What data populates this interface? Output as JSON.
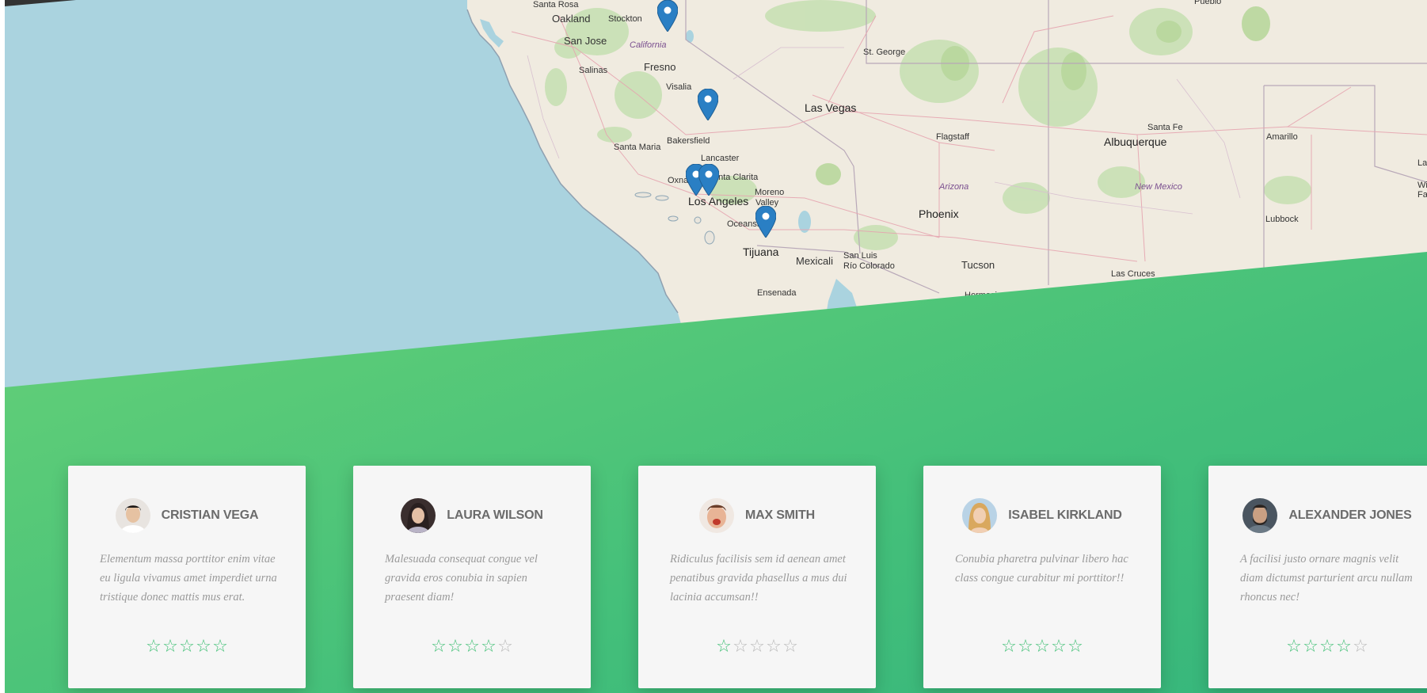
{
  "map": {
    "labels": [
      {
        "key": "santa_rosa",
        "text": "Santa Rosa"
      },
      {
        "key": "oakland",
        "text": "Oakland"
      },
      {
        "key": "stockton",
        "text": "Stockton"
      },
      {
        "key": "san_jose",
        "text": "San Jose"
      },
      {
        "key": "california",
        "text": "California"
      },
      {
        "key": "salinas",
        "text": "Salinas"
      },
      {
        "key": "fresno",
        "text": "Fresno"
      },
      {
        "key": "visalia",
        "text": "Visalia"
      },
      {
        "key": "bakersfield",
        "text": "Bakersfield"
      },
      {
        "key": "santa_maria",
        "text": "Santa Maria"
      },
      {
        "key": "lancaster",
        "text": "Lancaster"
      },
      {
        "key": "oxnard",
        "text": "Oxnar"
      },
      {
        "key": "santa_clarita",
        "text": "anta Clarita"
      },
      {
        "key": "los_angeles",
        "text": "Los Angeles"
      },
      {
        "key": "moreno_valley_1",
        "text": "Moreno"
      },
      {
        "key": "moreno_valley_2",
        "text": "Valley"
      },
      {
        "key": "oceanside",
        "text": "Oceansid"
      },
      {
        "key": "tijuana",
        "text": "Tijuana"
      },
      {
        "key": "mexicali",
        "text": "Mexicali"
      },
      {
        "key": "san_luis_1",
        "text": "San Luis"
      },
      {
        "key": "san_luis_2",
        "text": "Río Colorado"
      },
      {
        "key": "ensenada",
        "text": "Ensenada"
      },
      {
        "key": "las_vegas",
        "text": "Las Vegas"
      },
      {
        "key": "st_george",
        "text": "St. George"
      },
      {
        "key": "flagstaff",
        "text": "Flagstaff"
      },
      {
        "key": "arizona",
        "text": "Arizona"
      },
      {
        "key": "phoenix",
        "text": "Phoenix"
      },
      {
        "key": "tucson",
        "text": "Tucson"
      },
      {
        "key": "hermosillo",
        "text": "Hermosi"
      },
      {
        "key": "albuquerque",
        "text": "Albuquerque"
      },
      {
        "key": "santa_fe",
        "text": "Santa Fe"
      },
      {
        "key": "new_mexico",
        "text": "New Mexico"
      },
      {
        "key": "las_cruces",
        "text": "Las Cruces"
      },
      {
        "key": "amarillo",
        "text": "Amarillo"
      },
      {
        "key": "lubbock",
        "text": "Lubbock"
      },
      {
        "key": "pueblo",
        "text": "Pueblo"
      },
      {
        "key": "law",
        "text": "Law"
      },
      {
        "key": "wic",
        "text": "Wic"
      },
      {
        "key": "fa",
        "text": "Fa"
      }
    ],
    "marker_icon": "map-pin-icon",
    "marker_color": "#2a7fc4"
  },
  "colors": {
    "green_start": "#79d477",
    "green_end": "#35b57c",
    "star_on": "#3fbf74",
    "star_off": "#b8b8b8"
  },
  "testimonials": [
    {
      "name": "CRISTIAN VEGA",
      "text": "Elementum massa porttitor enim vitae eu ligula vivamus amet imperdiet urna tristique donec mattis mus erat.",
      "rating": 5,
      "stars": [
        "☆",
        "☆",
        "☆",
        "☆",
        "☆"
      ]
    },
    {
      "name": "LAURA WILSON",
      "text": "Malesuada consequat congue vel gravida eros conubia in sapien praesent diam!",
      "rating": 4,
      "stars": [
        "☆",
        "☆",
        "☆",
        "☆",
        "☆"
      ]
    },
    {
      "name": "MAX SMITH",
      "text": "Ridiculus facilisis sem id aenean amet penatibus gravida phasellus a mus dui lacinia accumsan!!",
      "rating": 1,
      "stars": [
        "☆",
        "☆",
        "☆",
        "☆",
        "☆"
      ]
    },
    {
      "name": "ISABEL KIRKLAND",
      "text": "Conubia pharetra pulvinar libero hac class congue curabitur mi porttitor!!",
      "rating": 5,
      "stars": [
        "☆",
        "☆",
        "☆",
        "☆",
        "☆"
      ]
    },
    {
      "name": "ALEXANDER JONES",
      "text": "A facilisi justo ornare magnis velit diam dictumst parturient arcu nullam rhoncus nec!",
      "rating": 4,
      "stars": [
        "☆",
        "☆",
        "☆",
        "☆",
        "☆"
      ]
    }
  ]
}
